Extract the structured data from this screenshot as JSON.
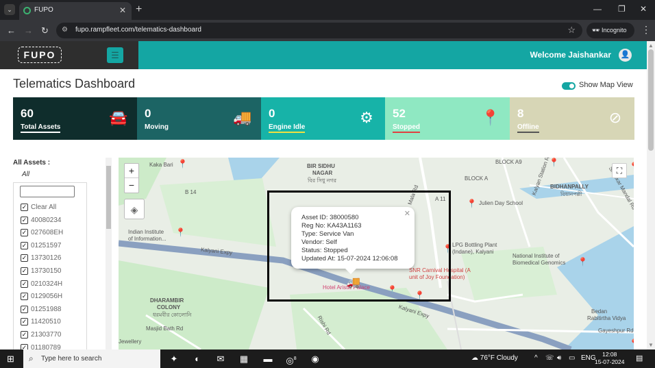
{
  "browser": {
    "tab_title": "FUPO",
    "url": "fupo.rampfleet.com/telematics-dashboard",
    "incognito_label": "Incognito"
  },
  "header": {
    "logo": "FUPO",
    "welcome": "Welcome Jaishankar"
  },
  "page": {
    "title": "Telematics Dashboard",
    "map_toggle_label": "Show Map View"
  },
  "stats": [
    {
      "value": "60",
      "label": "Total Assets",
      "bg": "#0f2d2c",
      "fg": "#ffffff",
      "underline": "#ffffff"
    },
    {
      "value": "0",
      "label": "Moving",
      "bg": "#1c6464",
      "fg": "#ffffff",
      "underline": "#1c6464"
    },
    {
      "value": "0",
      "label": "Engine Idle",
      "bg": "#17b3a8",
      "fg": "#ffffff",
      "underline": "#f0e040"
    },
    {
      "value": "52",
      "label": "Stopped",
      "bg": "#8fe8c2",
      "fg": "#ffffff",
      "underline": "#e04040"
    },
    {
      "value": "8",
      "label": "Offline",
      "bg": "#d7d6b6",
      "fg": "#ffffff",
      "underline": "#555555"
    }
  ],
  "sidebar": {
    "title": "All Assets :",
    "all_label": "All",
    "items": [
      "Clear All",
      "40080234",
      "027608EH",
      "01251597",
      "13730126",
      "13730150",
      "0210324H",
      "0129056H",
      "01251988",
      "11420510",
      "21303770",
      "01180789"
    ]
  },
  "map": {
    "labels": {
      "kaka_bari": "Kaka Bari",
      "bir_sidhu": "BIR SIDHU",
      "nagar": "NAGAR",
      "nagar_bn": "বির সিধু নগর",
      "b14": "B 14",
      "a11": "A 11",
      "block_a9": "BLOCK A9",
      "block_a": "BLOCK A",
      "bidhanpally": "BIDHANPALLY",
      "bidhanpally_bn": "বিধানপল্লী",
      "julien": "Julien Day School",
      "iit_1": "Indian Institute",
      "iit_2": "of Information...",
      "lpg_1": "LPG Bottling Plant",
      "lpg_2": "(Indane), Kalyani",
      "nibg_1": "National Institute of",
      "nibg_2": "Biomedical Genomics",
      "snr_1": "SNR Carnival Hospital (A",
      "snr_2": "unit of Joy Foundation)",
      "hotel": "Hotel Aristic Palace",
      "kalyani_expy": "Kalyani Expy",
      "kalyani_expy2": "Kalyani Expy",
      "dharambir_1": "DHARAMBIR",
      "dharambir_2": "COLONY",
      "dharambir_bn": "ধরমবীর কোলোনি",
      "masjid": "Masjid Bath Rd",
      "rabi_1": "Bedan",
      "rabi_2": "Rabitirtha Vidya",
      "gayeshpur": "Gayeshpur Rd",
      "jewellery": "Jewellery",
      "rishi_rd": "Rishi Rd",
      "kalyan_station": "Kalyan Station Rd",
      "shankar_mandal": "Shankar Mandal Rd",
      "mala_rd": "Mala Rd"
    },
    "popup": {
      "asset_id": "Asset ID: 38000580",
      "reg_no": "Reg No: KA43A1163",
      "type": "Type: Service Van",
      "vendor": "Vendor: Self",
      "status": "Status: Stopped",
      "updated": "Updated At: 15-07-2024 12:06:08"
    }
  },
  "taskbar": {
    "search_placeholder": "Type here to search",
    "weather": "76°F  Cloudy",
    "lang": "ENG",
    "time": "12:08",
    "date": "15-07-2024",
    "whatsapp_badge": "8"
  },
  "colors": {
    "accent": "#14a6a3",
    "header_dark": "#2e2e2e"
  }
}
